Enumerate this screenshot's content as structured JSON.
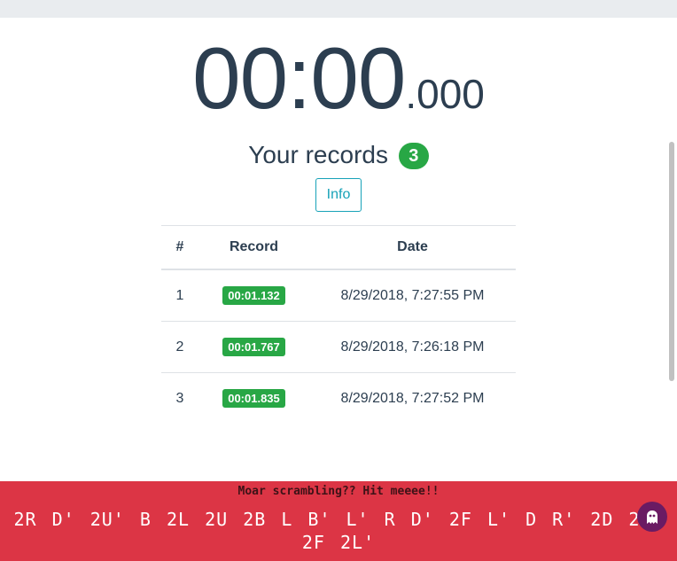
{
  "timer": {
    "main": "00:00",
    "ms": ".000"
  },
  "records": {
    "title": "Your records",
    "count": "3",
    "info_label": "Info",
    "columns": [
      "#",
      "Record",
      "Date"
    ],
    "rows": [
      {
        "index": "1",
        "time": "00:01.132",
        "date": "8/29/2018, 7:27:55 PM"
      },
      {
        "index": "2",
        "time": "00:01.767",
        "date": "8/29/2018, 7:26:18 PM"
      },
      {
        "index": "3",
        "time": "00:01.835",
        "date": "8/29/2018, 7:27:52 PM"
      }
    ]
  },
  "footer": {
    "hint": "Moar scrambling?? Hit meeee!!",
    "scramble": "2R D' 2U' B 2L 2U 2B L B' L' R D' 2F L' D R' 2D 2R' 2F 2L'"
  },
  "icons": {
    "ghost_button": "ghost-icon"
  },
  "colors": {
    "badge_green": "#28a745",
    "info_teal": "#17a2b8",
    "footer_red": "#dc3545",
    "ghost_purple": "#6a1b63"
  }
}
